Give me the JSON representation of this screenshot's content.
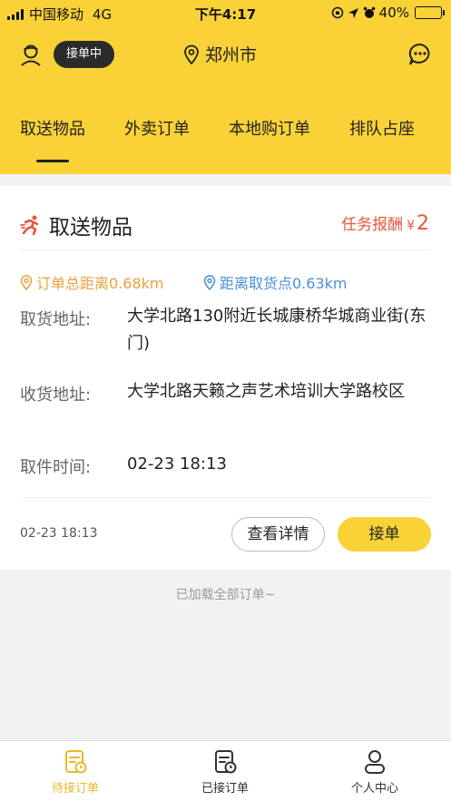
{
  "status_bar": {
    "carrier": "中国移动",
    "network": "4G",
    "time": "下午4:17",
    "battery": "40%",
    "battery_level": 0.4
  },
  "header": {
    "status_label": "接单中",
    "city": "郑州市"
  },
  "tabs": [
    {
      "label": "取送物品",
      "active": true
    },
    {
      "label": "外卖订单",
      "active": false
    },
    {
      "label": "本地购订单",
      "active": false
    },
    {
      "label": "排队占座",
      "active": false
    }
  ],
  "order": {
    "type_title": "取送物品",
    "reward_label": "任务报酬",
    "reward_currency": "¥",
    "reward_value": "2",
    "total_distance": "订单总距离0.68km",
    "pickup_distance": "距离取货点0.63km",
    "pickup_label": "取货地址:",
    "pickup_address": "大学北路130附近长城康桥华城商业街(东门)",
    "delivery_label": "收货地址:",
    "delivery_address": "大学北路天籁之声艺术培训大学路校区",
    "pickup_time_label": "取件时间:",
    "pickup_time": "02-23 18:13",
    "order_time": "02-23 18:13",
    "detail_button": "查看详情",
    "accept_button": "接单"
  },
  "footer_text": "已加载全部订单~",
  "bottom_nav": [
    {
      "label": "待接订单",
      "icon": "pending-orders-icon",
      "active": true
    },
    {
      "label": "已接订单",
      "icon": "accepted-orders-icon",
      "active": false
    },
    {
      "label": "个人中心",
      "icon": "person-icon",
      "active": false
    }
  ],
  "colors": {
    "brand_yellow": "#f9d238",
    "reward_red": "#e8573a",
    "distance_orange": "#e9a23b",
    "distance_blue": "#4a8fd6"
  }
}
